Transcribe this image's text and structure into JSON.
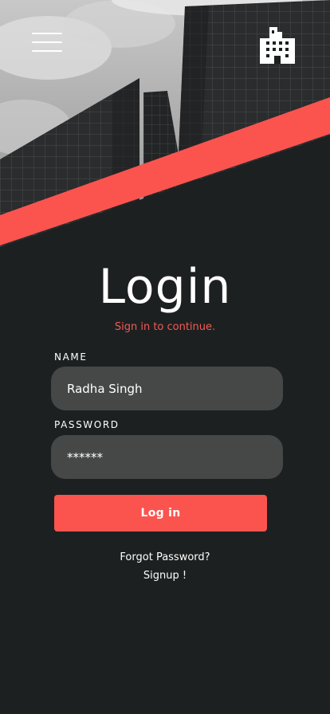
{
  "header": {
    "menu_icon": "hamburger-menu-icon",
    "logo_icon": "building-icon"
  },
  "login": {
    "title": "Login",
    "subtitle": "Sign in to continue.",
    "name_label": "NAME",
    "name_value": "Radha Singh",
    "password_label": "PASSWORD",
    "password_value": "******",
    "submit_label": "Log in",
    "forgot_label": "Forgot Password?",
    "signup_label": "Signup !"
  },
  "colors": {
    "accent": "#fb544f",
    "background": "#1d2020",
    "input_background": "#464848",
    "subtitle": "#f25a55"
  }
}
